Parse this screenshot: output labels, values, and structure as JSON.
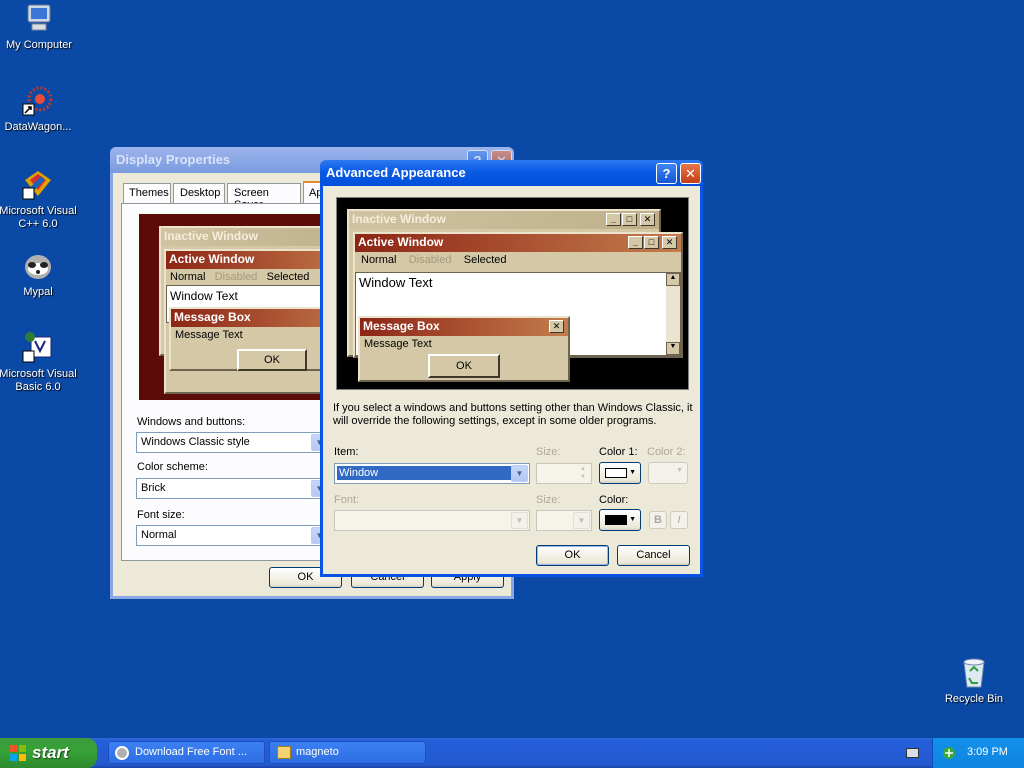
{
  "desktop": {
    "icons": [
      {
        "label": "My Computer",
        "icon": "my-computer-icon"
      },
      {
        "label": "DataWagon...",
        "icon": "datawagon-shortcut-icon"
      },
      {
        "label": "Microsoft Visual C++ 6.0",
        "icon": "visual-cpp-icon"
      },
      {
        "label": "Mypal",
        "icon": "mypal-browser-icon"
      },
      {
        "label": "Microsoft Visual Basic 6.0",
        "icon": "visual-basic-icon"
      },
      {
        "label": "Recycle Bin",
        "icon": "recycle-bin-icon"
      }
    ],
    "background_color": "#0a4aa6"
  },
  "display_properties": {
    "title": "Display Properties",
    "tabs": [
      "Themes",
      "Desktop",
      "Screen Saver",
      "Ap"
    ],
    "preview": {
      "inactive_title": "Inactive Window",
      "active_title": "Active Window",
      "menu": [
        "Normal",
        "Disabled",
        "Selected"
      ],
      "window_text": "Window Text",
      "message_box_title": "Message Box",
      "message_text": "Message Text",
      "ok": "OK"
    },
    "windows_buttons_label": "Windows and buttons:",
    "windows_buttons_value": "Windows Classic style",
    "color_scheme_label": "Color scheme:",
    "color_scheme_value": "Brick",
    "font_size_label": "Font size:",
    "font_size_value": "Normal",
    "buttons": {
      "ok": "OK",
      "cancel": "Cancel",
      "apply": "Apply"
    }
  },
  "advanced_appearance": {
    "title": "Advanced Appearance",
    "preview": {
      "inactive_title": "Inactive Window",
      "active_title": "Active Window",
      "menu": [
        "Normal",
        "Disabled",
        "Selected"
      ],
      "window_text": "Window Text",
      "message_box_title": "Message Box",
      "message_text": "Message Text",
      "ok": "OK"
    },
    "info_text": "If you select a windows and buttons setting other than Windows Classic, it will override the following settings, except in some older programs.",
    "item_label": "Item:",
    "item_value": "Window",
    "size_label": "Size:",
    "color1_label": "Color 1:",
    "color2_label": "Color 2:",
    "font_label": "Font:",
    "font_size_label": "Size:",
    "color_label": "Color:",
    "color1_value": "#ffffff",
    "font_color_value": "#000000",
    "bold_label": "B",
    "italic_label": "I",
    "ok": "OK",
    "cancel": "Cancel"
  },
  "taskbar": {
    "start_label": "start",
    "tasks": [
      {
        "label": "Download Free Font ...",
        "icon": "mypal-browser-icon"
      },
      {
        "label": "magneto",
        "icon": "folder-icon"
      }
    ],
    "clock": "3:09 PM"
  }
}
